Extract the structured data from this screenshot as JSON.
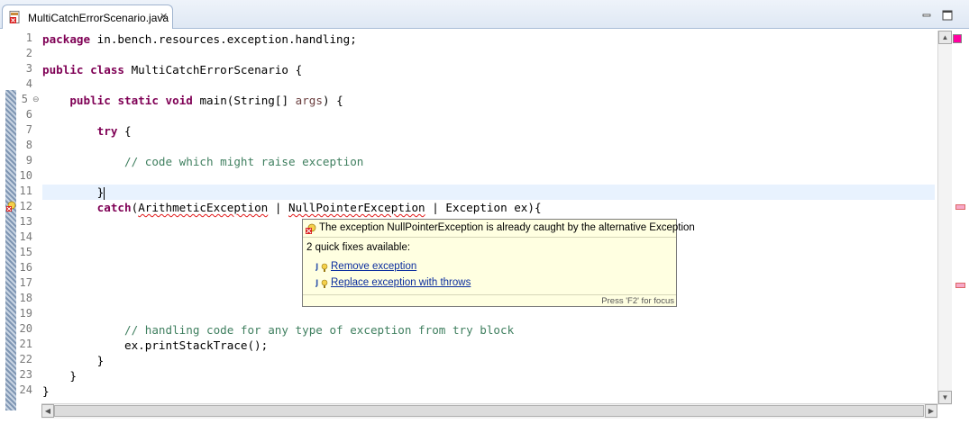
{
  "tab": {
    "title": "MultiCatchErrorScenario.java",
    "close": "✕"
  },
  "gutter": {
    "line_numbers": [
      "1",
      "2",
      "3",
      "4",
      "5",
      "6",
      "7",
      "8",
      "9",
      "10",
      "11",
      "12",
      "13",
      "14",
      "15",
      "16",
      "17",
      "18",
      "19",
      "20",
      "21",
      "22",
      "23",
      "24"
    ],
    "fold_glyph": "⊖"
  },
  "code": {
    "l1_kw": "package",
    "l1_text": " in.bench.resources.exception.handling;",
    "l3_kw1": "public",
    "l3_kw2": "class",
    "l3_text": " MultiCatchErrorScenario {",
    "l5_kw1": "public",
    "l5_kw2": "static",
    "l5_kw3": "void",
    "l5_text1": " main(String[] ",
    "l5_param": "args",
    "l5_text2": ") {",
    "l7_kw": "try",
    "l7_text": " {",
    "l9_comment": "// code which might raise exception",
    "l11_text": "}",
    "l12_kw": "catch",
    "l12_open": "(",
    "l12_ex1": "ArithmeticException",
    "l12_sep1": " | ",
    "l12_ex2": "NullPointerException",
    "l12_sep2": " | ",
    "l12_rest": "Exception ex){",
    "l20_comment": "// handling code for any type of exception from try block",
    "l21_text": "ex.printStackTrace();",
    "l22_text": "}",
    "l23_text": "}",
    "l24_text": "}"
  },
  "popup": {
    "title": "The exception NullPointerException is already caught by the alternative Exception",
    "count": "2 quick fixes available:",
    "fixes": [
      "Remove exception",
      "Replace exception with throws"
    ],
    "hint": "Press 'F2' for focus"
  },
  "colors": {
    "keyword": "#7f0055",
    "comment": "#3f7f5f",
    "error_underline": "#e21b1b",
    "current_line": "#e8f2fe",
    "popup_bg": "#ffffe1",
    "link": "#0b2d9e"
  }
}
